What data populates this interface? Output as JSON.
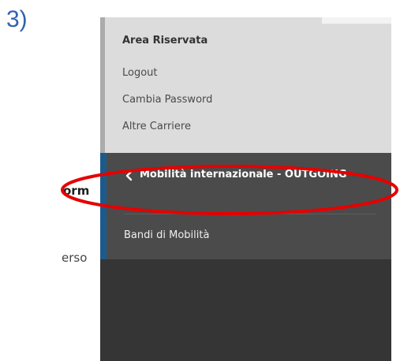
{
  "step_label": "3)",
  "background_fragments": [
    "orm",
    "erso"
  ],
  "menu": {
    "section_title": "Area Riservata",
    "links": [
      "Logout",
      "Cambia Password",
      "Altre Carriere"
    ],
    "active_section": {
      "back_icon": "chevron-left-icon",
      "title": "Mobilità internazionale - OUTGOING"
    },
    "submenu_links": [
      "Bandi di Mobilità"
    ]
  },
  "colors": {
    "step_label": "#2f63b3",
    "menu_light_bg": "#dcdcdc",
    "menu_dark_bg": "#4b4b4b",
    "menu_darker_bg": "#353535",
    "accent_blue": "#1d5a8c",
    "highlight_red": "#e60000"
  }
}
